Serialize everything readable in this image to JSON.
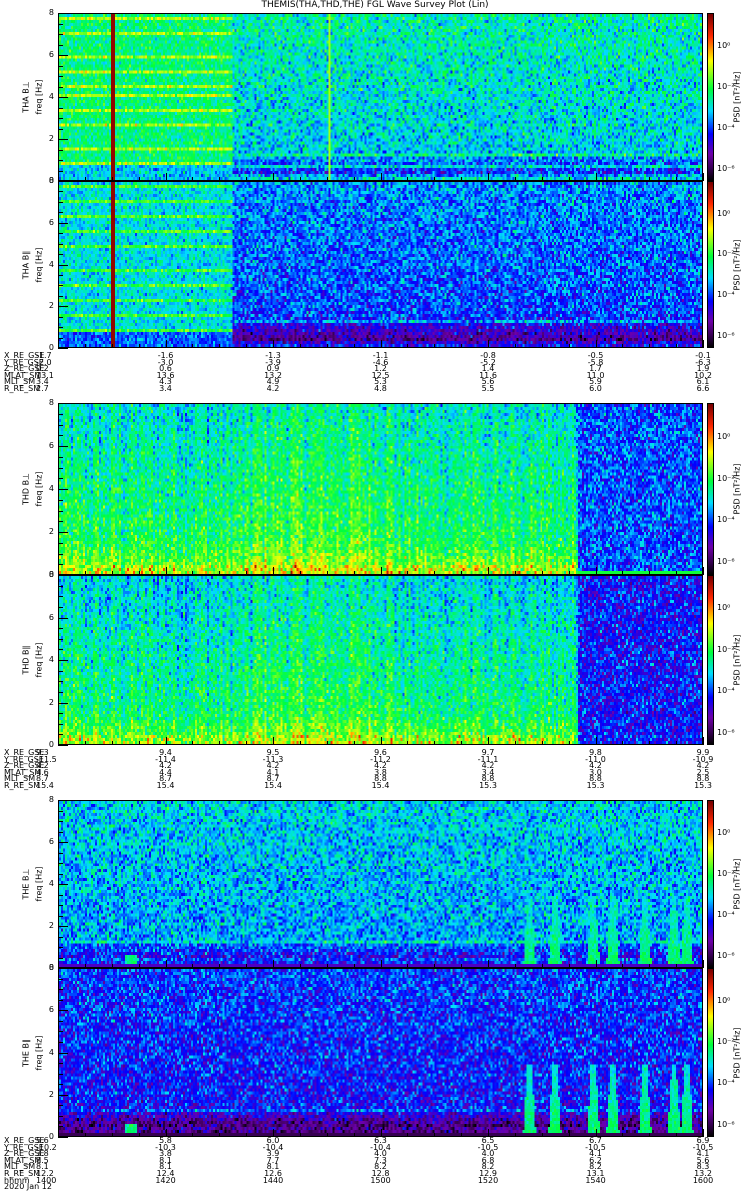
{
  "title": "THEMIS(THA,THD,THE) FGL Wave Survey Plot (Lin)",
  "colorbar": {
    "label": "PSD [nT²/Hz]",
    "ticks": [
      "10⁰",
      "10⁻²",
      "10⁻⁴",
      "10⁻⁶"
    ],
    "tick_values_log10": [
      0,
      -2,
      -4,
      -6
    ]
  },
  "panels": [
    {
      "probe": "THA",
      "label": "THA B⊥",
      "ylabel": "freq [Hz]",
      "yticks": [
        "0",
        "2",
        "4",
        "6",
        "8"
      ]
    },
    {
      "probe": "THA",
      "label": "THA B∥",
      "ylabel": "freq [Hz]",
      "yticks": [
        "0",
        "2",
        "4",
        "6",
        "8"
      ]
    },
    {
      "probe": "THD",
      "label": "THD B⊥",
      "ylabel": "freq [Hz]",
      "yticks": [
        "0",
        "2",
        "4",
        "6",
        "8"
      ]
    },
    {
      "probe": "THD",
      "label": "THD B∥",
      "ylabel": "freq [Hz]",
      "yticks": [
        "0",
        "2",
        "4",
        "6",
        "8"
      ]
    },
    {
      "probe": "THE",
      "label": "THE B⊥",
      "ylabel": "freq [Hz]",
      "yticks": [
        "0",
        "2",
        "4",
        "6",
        "8"
      ]
    },
    {
      "probe": "THE",
      "label": "THE B∥",
      "ylabel": "freq [Hz]",
      "yticks": [
        "0",
        "2",
        "4",
        "6",
        "8"
      ]
    }
  ],
  "ephemeris": [
    {
      "rows": [
        {
          "name": "X_RE_GSE",
          "values": [
            "-1.7",
            "-1.6",
            "-1.3",
            "-1.1",
            "-0.8",
            "-0.5",
            "-0.1"
          ]
        },
        {
          "name": "Y_RE_GSE",
          "values": [
            "-2.0",
            "-3.0",
            "-3.9",
            "-4.6",
            "-5.2",
            "-5.8",
            "-6.3"
          ]
        },
        {
          "name": "Z_RE_GSE",
          "values": [
            "0.2",
            "0.6",
            "0.9",
            "1.2",
            "1.4",
            "1.7",
            "1.9"
          ]
        },
        {
          "name": "MLAT_SM",
          "values": [
            "13.1",
            "13.6",
            "13.2",
            "12.5",
            "11.6",
            "11.0",
            "10.2"
          ]
        },
        {
          "name": "MLT_SM",
          "values": [
            "3.4",
            "4.3",
            "4.9",
            "5.3",
            "5.6",
            "5.9",
            "6.1"
          ]
        },
        {
          "name": "R_RE_SM",
          "values": [
            "2.7",
            "3.4",
            "4.2",
            "4.8",
            "5.5",
            "6.0",
            "6.6"
          ]
        }
      ]
    },
    {
      "rows": [
        {
          "name": "X_RE_GSE",
          "values": [
            "9.3",
            "9.4",
            "9.5",
            "9.6",
            "9.7",
            "9.8",
            "9.9"
          ]
        },
        {
          "name": "Y_RE_GSE",
          "values": [
            "-11.5",
            "-11.4",
            "-11.3",
            "-11.2",
            "-11.1",
            "-11.0",
            "-10.9"
          ]
        },
        {
          "name": "Z_RE_GSE",
          "values": [
            "4.2",
            "4.2",
            "4.2",
            "4.2",
            "4.2",
            "4.2",
            "4.2"
          ]
        },
        {
          "name": "MLAT_SM",
          "values": [
            "4.6",
            "4.4",
            "4.1",
            "3.8",
            "3.4",
            "3.0",
            "2.5"
          ]
        },
        {
          "name": "MLT_SM",
          "values": [
            "8.7",
            "8.7",
            "8.7",
            "8.8",
            "8.8",
            "8.8",
            "8.8"
          ]
        },
        {
          "name": "R_RE_SM",
          "values": [
            "15.4",
            "15.4",
            "15.4",
            "15.4",
            "15.3",
            "15.3",
            "15.3"
          ]
        }
      ]
    },
    {
      "rows": [
        {
          "name": "X_RE_GSE",
          "values": [
            "5.6",
            "5.8",
            "6.0",
            "6.3",
            "6.5",
            "6.7",
            "6.9"
          ]
        },
        {
          "name": "Y_RE_GSE",
          "values": [
            "-10.2",
            "-10.3",
            "-10.4",
            "-10.4",
            "-10.5",
            "-10.5",
            "-10.5"
          ]
        },
        {
          "name": "Z_RE_GSE",
          "values": [
            "3.8",
            "3.8",
            "3.9",
            "4.0",
            "4.0",
            "4.1",
            "4.1"
          ]
        },
        {
          "name": "MLAT_SM",
          "values": [
            "8.5",
            "8.1",
            "7.7",
            "7.3",
            "6.8",
            "6.2",
            "5.6"
          ]
        },
        {
          "name": "MLT_SM",
          "values": [
            "8.1",
            "8.1",
            "8.1",
            "8.2",
            "8.2",
            "8.2",
            "8.3"
          ]
        },
        {
          "name": "R_RE_SM",
          "values": [
            "12.2",
            "12.4",
            "12.6",
            "12.8",
            "12.9",
            "13.1",
            "13.2"
          ]
        },
        {
          "name": "hhmm",
          "values": [
            "1400",
            "1420",
            "1440",
            "1500",
            "1520",
            "1540",
            "1600"
          ]
        }
      ],
      "date": "2020 Jan 12"
    }
  ],
  "chart_data": {
    "type": "heatmap",
    "title": "THEMIS(THA,THD,THE) FGL Wave Survey Plot (Lin)",
    "xlabel": "hhmm",
    "x_ticks": [
      "1400",
      "1420",
      "1440",
      "1500",
      "1520",
      "1540",
      "1600"
    ],
    "xlim": [
      "1400",
      "1600"
    ],
    "ylabel": "freq [Hz]",
    "ylim": [
      0,
      8
    ],
    "colorbar_log10_range": [
      -6.6,
      1.6
    ],
    "colorbar_label": "PSD [nT²/Hz]",
    "series": [
      {
        "name": "THA B⊥"
      },
      {
        "name": "THA B∥"
      },
      {
        "name": "THD B⊥"
      },
      {
        "name": "THD B∥"
      },
      {
        "name": "THE B⊥"
      },
      {
        "name": "THE B∥"
      }
    ]
  }
}
